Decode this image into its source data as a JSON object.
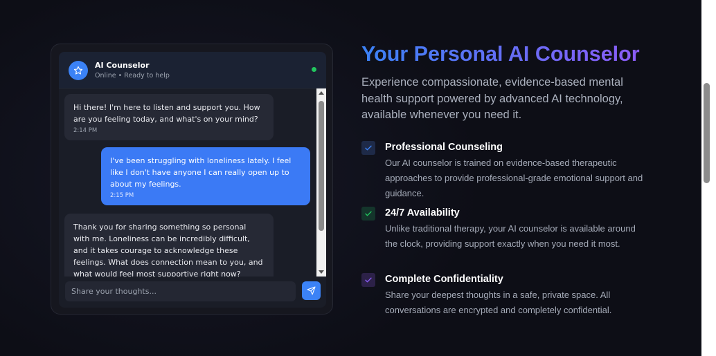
{
  "chat": {
    "title": "AI Counselor",
    "status": "Online • Ready to help",
    "messages": [
      {
        "role": "ai",
        "text": "Hi there! I'm here to listen and support you. How are you feeling today, and what's on your mind?",
        "time": "2:14 PM"
      },
      {
        "role": "user",
        "text": "I've been struggling with loneliness lately. I feel like I don't have anyone I can really open up to about my feelings.",
        "time": "2:15 PM"
      },
      {
        "role": "ai",
        "text": "Thank you for sharing something so personal with me. Loneliness can be incredibly difficult, and it takes courage to acknowledge these feelings. What does connection mean to you, and what would feel most supportive right now?",
        "time": ""
      }
    ],
    "input_placeholder": "Share your thoughts..."
  },
  "hero": {
    "title": "Your Personal AI Counselor",
    "subtitle": "Experience compassionate, evidence-based mental health support powered by advanced AI technology, available whenever you need it."
  },
  "features": [
    {
      "title": "Professional Counseling",
      "description": "Our AI counselor is trained on evidence-based therapeutic approaches to provide professional-grade emotional support and guidance.",
      "check_color": "#3b82f6"
    },
    {
      "title": "24/7 Availability",
      "description": "Unlike traditional therapy, your AI counselor is available around the clock, providing support exactly when you need it most.",
      "check_color": "#22c55e"
    },
    {
      "title": "Complete Confidentiality",
      "description": "Share your deepest thoughts in a safe, private space. All conversations are encrypted and completely confidential.",
      "check_color": "#8b5cf6"
    }
  ],
  "icons": {
    "avatar": "star-icon",
    "send": "send-icon",
    "feature_check": "check-icon",
    "online": "online-status-dot"
  },
  "colors": {
    "accent": "#3b82f6",
    "gradient_end": "#8b5cf6",
    "online": "#22c55e",
    "background": "#0d0e16"
  }
}
